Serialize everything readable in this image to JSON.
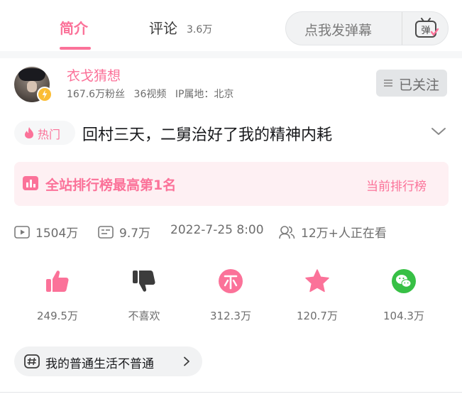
{
  "colors": {
    "accent": "#fb7299",
    "muted": "#6d6d6d",
    "text": "#18191c",
    "like_dark": "#3c3c3c",
    "wechat": "#37c045"
  },
  "tabs": {
    "intro_label": "简介",
    "comment_label": "评论",
    "comment_count": "3.6万"
  },
  "danmaku": {
    "placeholder": "点我发弹幕",
    "icon": "danmaku-toggle-icon",
    "icon_text": "弹"
  },
  "author": {
    "name": "衣戈猜想",
    "fans": "167.6万粉丝",
    "videos": "36视频",
    "ip": "IP属地：北京",
    "follow_label": "已关注"
  },
  "video": {
    "hot_label": "热门",
    "title": "回村三天，二舅治好了我的精神内耗"
  },
  "ranking": {
    "text": "全站排行榜最高第1名",
    "link": "当前排行榜"
  },
  "stats": {
    "plays": "1504万",
    "danmaku_count": "9.7万",
    "publish_time": "2022-7-25 8:00",
    "watching": "12万+人正在看"
  },
  "actions": [
    {
      "icon": "like-icon",
      "count": "249.5万"
    },
    {
      "icon": "dislike-icon",
      "count": "不喜欢"
    },
    {
      "icon": "coin-icon",
      "count": "312.3万"
    },
    {
      "icon": "favorite-icon",
      "count": "120.7万"
    },
    {
      "icon": "wechat-share-icon",
      "count": "104.3万"
    }
  ],
  "tag": {
    "label": "我的普通生活不普通"
  }
}
